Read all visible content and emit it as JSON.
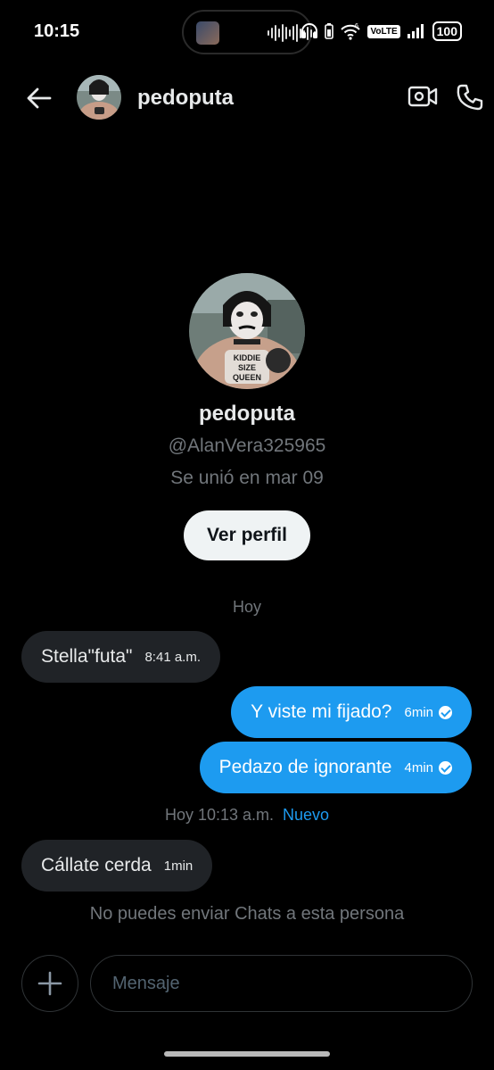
{
  "status_bar": {
    "time": "10:15",
    "network_badge": "VoLTE",
    "battery": "100",
    "icons": [
      "headphones-icon",
      "battery-saver-icon",
      "wifi-6-icon",
      "signal-icon"
    ]
  },
  "header": {
    "back_icon": "arrow-left-icon",
    "name": "pedoputa",
    "video_icon": "video-camera-icon",
    "call_icon": "phone-icon"
  },
  "profile": {
    "name": "pedoputa",
    "handle": "@AlanVera325965",
    "joined": "Se unió en mar 09",
    "view_profile_label": "Ver perfil",
    "avatar_text": [
      "KIDDIE",
      "SIZE",
      "QUEEN"
    ]
  },
  "conversation": {
    "day_label": "Hoy",
    "messages": [
      {
        "direction": "in",
        "text": "Stella\"futa\"",
        "time": "8:41 a.m."
      },
      {
        "direction": "out",
        "text": "Y viste mi fijado?",
        "time": "6min",
        "status": "read"
      },
      {
        "direction": "out",
        "text": "Pedazo de ignorante",
        "time": "4min",
        "status": "read"
      }
    ],
    "new_separator": {
      "time": "Hoy 10:13 a.m.",
      "label": "Nuevo"
    },
    "new_messages": [
      {
        "direction": "in",
        "text": "Cállate cerda",
        "time": "1min"
      }
    ],
    "notice": "No puedes enviar Chats a esta persona"
  },
  "composer": {
    "add_icon": "plus-icon",
    "placeholder": "Mensaje"
  },
  "colors": {
    "background": "#000000",
    "accent": "#1d9bf0",
    "incoming_bubble": "#202327",
    "muted_text": "#71767b"
  }
}
